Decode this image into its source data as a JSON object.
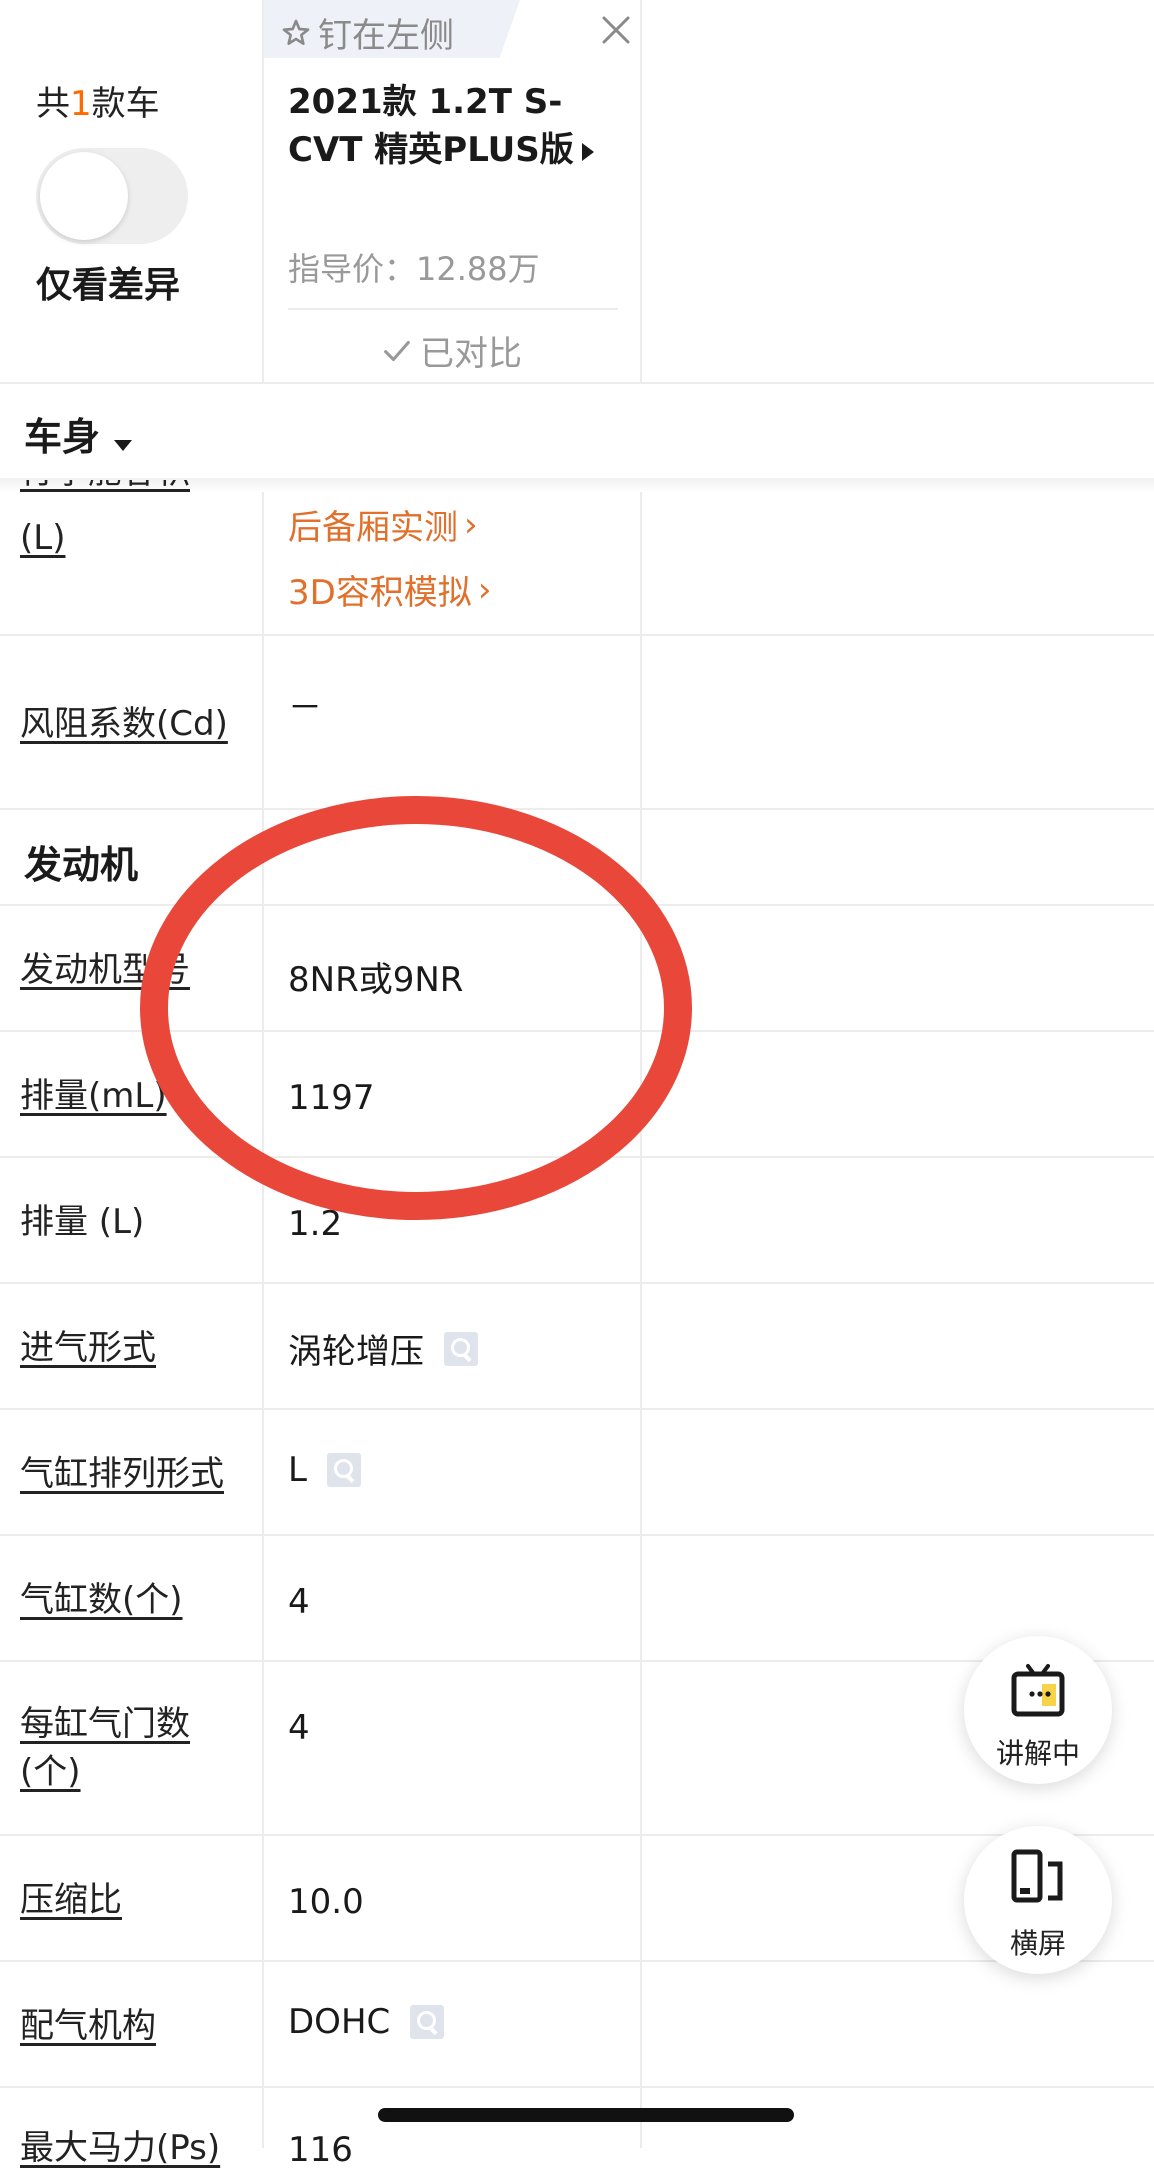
{
  "header": {
    "count_prefix": "共",
    "count_num": "1",
    "count_suffix": "款车",
    "diff_toggle_label": "仅看差异",
    "pin_label": "钉在左侧",
    "model_name": "2021款 1.2T S-CVT 精英PLUS版",
    "price": "指导价：12.88万",
    "compared_label": "已对比"
  },
  "body_section": {
    "title": "车身",
    "trunk_label_partial": "行李舱容积",
    "trunk_label_unit": "(L)",
    "trunk_links": [
      "后备厢实测",
      "3D容积模拟"
    ],
    "drag_label": "风阻系数(Cd)",
    "drag_value": "－"
  },
  "engine_section": {
    "title": "发动机",
    "rows": [
      {
        "label": "发动机型号",
        "value": "8NR或9NR"
      },
      {
        "label": "排量(mL)",
        "value": "1197"
      },
      {
        "label": "排量 (L)",
        "value": "1.2"
      },
      {
        "label": "进气形式",
        "value": "涡轮增压"
      },
      {
        "label": "气缸排列形式",
        "value": "L"
      },
      {
        "label": "气缸数(个)",
        "value": "4"
      },
      {
        "label": "每缸气门数(个)",
        "value": "4"
      },
      {
        "label": "压缩比",
        "value": "10.0"
      },
      {
        "label": "配气机构",
        "value": "DOHC"
      },
      {
        "label": "最大马力(Ps)",
        "value": "116"
      }
    ]
  },
  "floating": {
    "explain_label": "讲解中",
    "landscape_label": "横屏"
  },
  "colors": {
    "accent_orange": "#e0702b",
    "annotation_red": "#e8473a"
  }
}
